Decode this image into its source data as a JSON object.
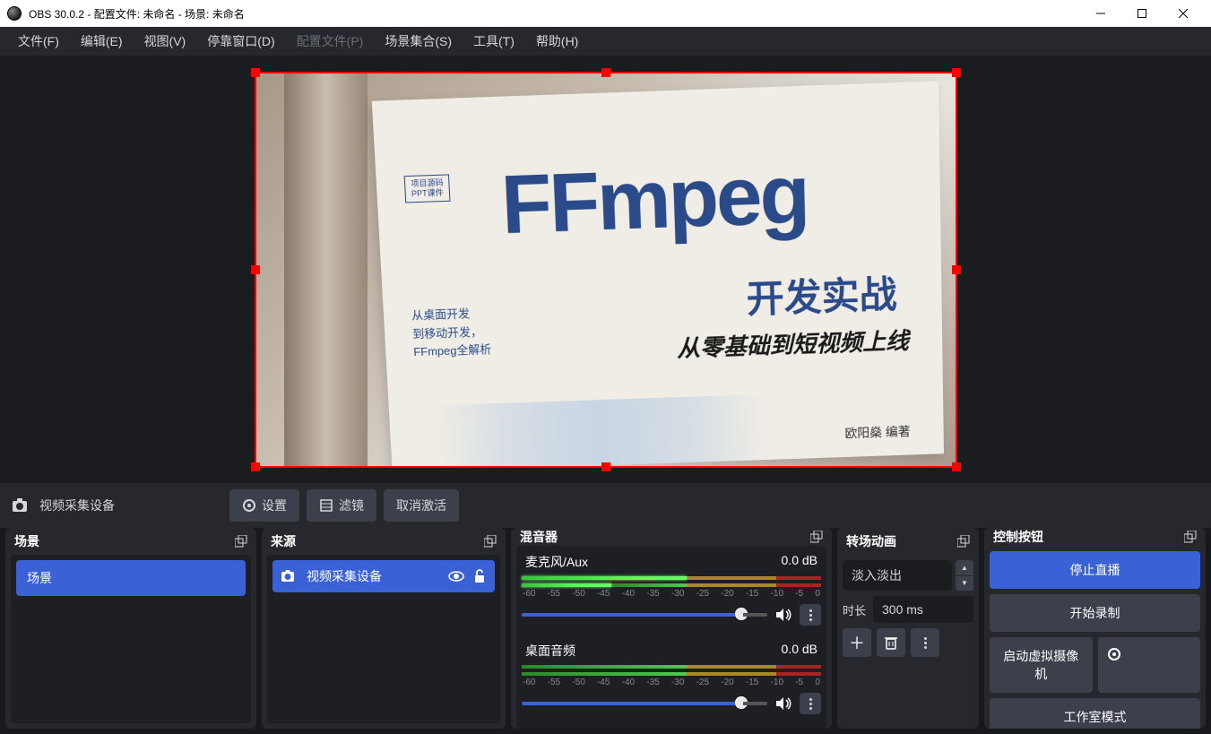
{
  "window": {
    "title": "OBS 30.0.2 - 配置文件: 未命名 - 场景: 未命名"
  },
  "menu": {
    "file": "文件(F)",
    "edit": "编辑(E)",
    "view": "视图(V)",
    "dock": "停靠窗口(D)",
    "profile": "配置文件(P)",
    "scene_collection": "场景集合(S)",
    "tools": "工具(T)",
    "help": "帮助(H)"
  },
  "source_bar": {
    "label": "视频采集设备",
    "settings": "设置",
    "filters": "滤镜",
    "deactivate": "取消激活"
  },
  "docks": {
    "scenes": "场景",
    "sources": "来源",
    "mixer": "混音器",
    "transitions": "转场动画",
    "controls": "控制按钮"
  },
  "scene_list": [
    "场景"
  ],
  "source_list": [
    {
      "name": "视频采集设备"
    }
  ],
  "mixer": {
    "channels": [
      {
        "name": "麦克风/Aux",
        "level": "0.0 dB"
      },
      {
        "name": "桌面音频",
        "level": "0.0 dB"
      }
    ],
    "ticks": [
      "-60",
      "-55",
      "-50",
      "-45",
      "-40",
      "-35",
      "-30",
      "-25",
      "-20",
      "-15",
      "-10",
      "-5",
      "0"
    ]
  },
  "transitions": {
    "selected": "淡入淡出",
    "duration_label": "时长",
    "duration": "300 ms"
  },
  "controls": {
    "stop_stream": "停止直播",
    "start_record": "开始录制",
    "virtual_cam": "启动虚拟摄像机",
    "studio_mode": "工作室模式"
  },
  "book": {
    "badge_l1": "项目源码",
    "badge_l2": "PPT课件",
    "title": "FFmpeg",
    "sub1_l1": "从桌面开发",
    "sub1_l2": "到移动开发，",
    "sub1_l3": "FFmpeg全解析",
    "sub2": "开发实战",
    "sub3": "从零基础到短视频上线",
    "author": "欧阳燊  编著"
  }
}
